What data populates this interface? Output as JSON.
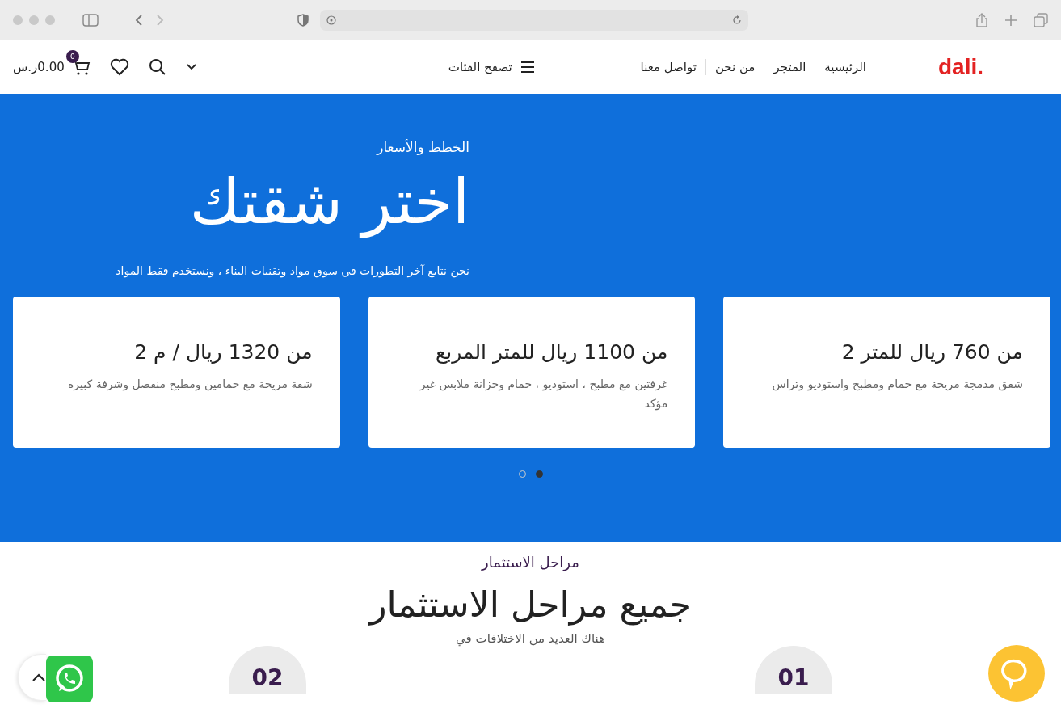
{
  "header": {
    "logo": "dali.",
    "nav": [
      {
        "label": "الرئيسية"
      },
      {
        "label": "المتجر"
      },
      {
        "label": "من نحن"
      },
      {
        "label": "تواصل معنا"
      }
    ],
    "categories": "تصفح الفئات",
    "cart_count": "0",
    "cart_total": "0.00ر.س"
  },
  "hero": {
    "eyebrow": "الخطط والأسعار",
    "title": "اختر شقتك",
    "text": "نحن نتابع آخر التطورات في سوق مواد وتقنيات البناء ، ونستخدم فقط المواد",
    "cards": [
      {
        "price": "من 760 ريال للمتر 2",
        "desc": "شقق مدمجة مريحة مع حمام ومطبخ واستوديو وتراس"
      },
      {
        "price": "من 1100 ريال للمتر المربع",
        "desc": "غرفتين مع مطبخ ، استوديو ، حمام وخزانة ملابس غير مؤكد"
      },
      {
        "price": "من 1320 ريال / م 2",
        "desc": "شقة مريحة مع حمامين ومطبخ منفصل وشرفة كبيرة"
      }
    ],
    "dots": [
      {
        "selected": true
      },
      {
        "selected": false
      }
    ]
  },
  "stages": {
    "eyebrow": "مراحل الاستثمار",
    "title": "جميع مراحل الاستثمار",
    "text": "هناك العديد من الاختلافات في",
    "steps": [
      "01",
      "02"
    ]
  }
}
